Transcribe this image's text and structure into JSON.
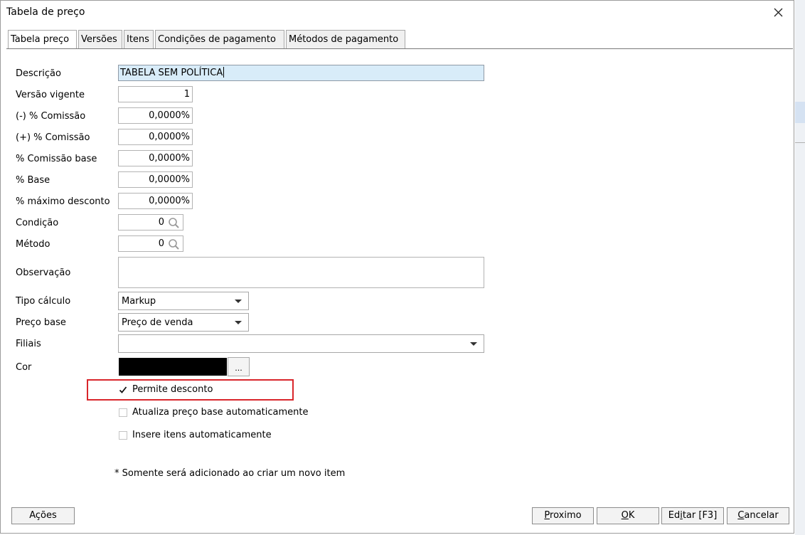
{
  "window": {
    "title": "Tabela de preço"
  },
  "tabs": [
    {
      "label": "Tabela preço",
      "active": true
    },
    {
      "label": "Versões"
    },
    {
      "label": "Itens"
    },
    {
      "label": "Condições de pagamento"
    },
    {
      "label": "Métodos de pagamento"
    }
  ],
  "form": {
    "descricao": {
      "label": "Descrição",
      "value": "TABELA SEM POLÍTICA"
    },
    "versao_vigente": {
      "label": "Versão vigente",
      "value": "1"
    },
    "comissao_menos": {
      "label": "(-) % Comissão",
      "value": "0,0000%"
    },
    "comissao_mais": {
      "label": "(+) % Comissão",
      "value": "0,0000%"
    },
    "comissao_base": {
      "label": "% Comissão base",
      "value": "0,0000%"
    },
    "base": {
      "label": "% Base",
      "value": "0,0000%"
    },
    "maximo_desconto": {
      "label": "% máximo desconto",
      "value": "0,0000%"
    },
    "condicao": {
      "label": "Condição",
      "value": "0"
    },
    "metodo": {
      "label": "Método",
      "value": "0"
    },
    "observacao": {
      "label": "Observação",
      "value": ""
    },
    "tipo_calculo": {
      "label": "Tipo cálculo",
      "value": "Markup"
    },
    "preco_base": {
      "label": "Preço base",
      "value": "Preço de venda"
    },
    "filiais": {
      "label": "Filiais",
      "value": ""
    },
    "cor": {
      "label": "Cor",
      "value_color": "#000000",
      "button_label": "..."
    }
  },
  "checkboxes": {
    "permite_desconto": {
      "label": "Permite desconto",
      "checked": true
    },
    "atualiza_preco": {
      "label": "Atualiza preço base automaticamente",
      "checked": false
    },
    "insere_itens": {
      "label": "Insere itens automaticamente",
      "checked": false
    }
  },
  "note": "* Somente será adicionado ao criar um novo item",
  "buttons": {
    "acoes": "Ações",
    "proximo_u": "P",
    "proximo_rest": "roximo",
    "ok_u": "O",
    "ok_rest": "K",
    "editar_pre": "Ed",
    "editar_u": "i",
    "editar_rest": "tar [F3]",
    "cancelar_u": "C",
    "cancelar_rest": "ancelar"
  },
  "colors": {
    "highlight": "#d9262b",
    "desc_bg": "#d8ecf9"
  }
}
